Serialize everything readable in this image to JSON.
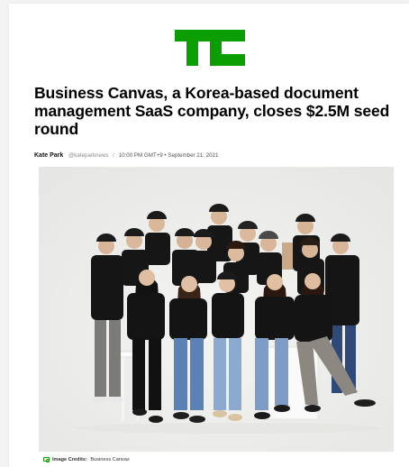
{
  "brand": {
    "logo": "techcrunch-logo",
    "accent": "#0a9e01"
  },
  "article": {
    "headline": "Business Canvas, a Korea-based document management SaaS company, closes $2.5M seed round",
    "author": "Kate Park",
    "handle": "@kateparknews",
    "separator": "/",
    "timestamp": "10:00 PM GMT+9 • September 21, 2021"
  },
  "image": {
    "credit_label": "Image Credits:",
    "credit_value": "Business Canvas",
    "credit_icon": "camera-icon"
  }
}
